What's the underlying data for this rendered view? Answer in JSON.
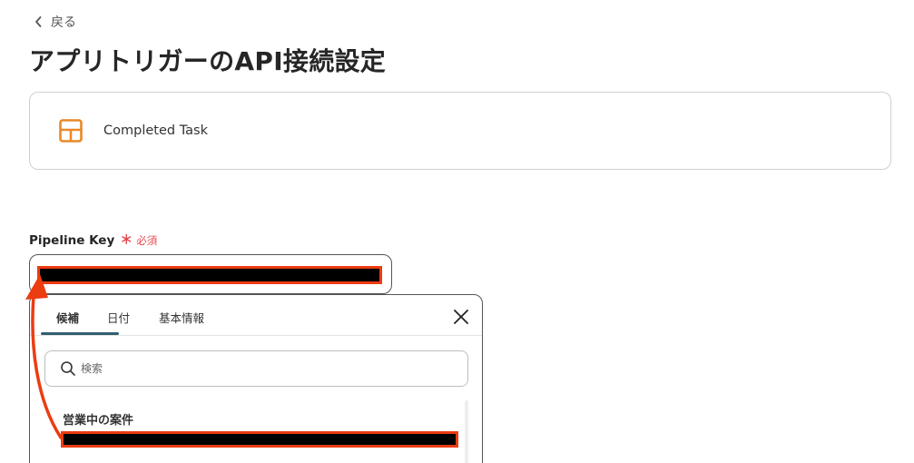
{
  "nav": {
    "back_label": "戻る"
  },
  "page": {
    "title": "アプリトリガーのAPI接続設定"
  },
  "trigger": {
    "name": "Completed Task",
    "icon": "table-layout-icon",
    "icon_color": "#e8892a"
  },
  "field": {
    "label": "Pipeline Key",
    "required_mark": "＊",
    "required_text": "必須",
    "value_redacted": true
  },
  "popup": {
    "tabs": [
      {
        "label": "候補",
        "active": true
      },
      {
        "label": "日付",
        "active": false
      },
      {
        "label": "基本情報",
        "active": false
      }
    ],
    "search_placeholder": "検索",
    "group_title": "営業中の案件",
    "option_redacted": true
  },
  "colors": {
    "accent_tab": "#2f5f70",
    "required": "#e5484d",
    "annotation": "#ec3c12",
    "icon_orange": "#e8892a"
  }
}
